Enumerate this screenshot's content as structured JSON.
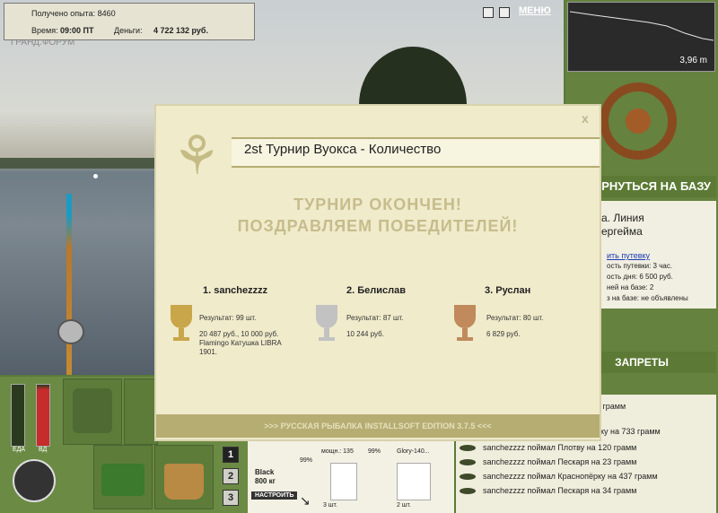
{
  "hud": {
    "experience": "Получено опыта: 8460",
    "time_label": "Время:",
    "time_value": "09:00 ПТ",
    "money_label": "Деньги:",
    "money_value": "4 722 132 руб.",
    "menu_label": "МЕНЮ",
    "depth": "3,96 m",
    "scene_watermark": "ГРАНД.ФОРУМ"
  },
  "right_panel": {
    "base_button": "РНУТЬСЯ НА БАЗУ",
    "location_line1": "а. Линия",
    "location_line2": "ергейма",
    "voucher_link": "ить путевку",
    "voucher_cost": "ость путевки: 3 час.",
    "day_cost": "ость дня: 6 500 руб.",
    "days_on_base": "ней на базе: 2",
    "tournament_status": "з на базе: не объявлены",
    "bans_label": "ЗАПРЕТЫ"
  },
  "log": {
    "rows": [
      "4 грамм",
      "рку на 733 грамм",
      "sanchezzzz поймал Плотву на 120 грамм",
      "sanchezzzz поймал Пескаря на 23 грамм",
      "sanchezzzz поймал Краснопёрку на 437 грамм",
      "sanchezzzz поймал Пескаря на 34 грамм"
    ]
  },
  "bottom": {
    "food_label": "ЕДА",
    "drink_label": "ВД",
    "page_buttons": [
      "1",
      "2",
      "3"
    ],
    "tackle_name": "Black",
    "tackle_weight": "800 кг",
    "tackle_percent": "99%",
    "adjust_button": "НАСТРОИТЬ",
    "inv_item1": "мощн.: 135",
    "inv_item1_pct": "99%",
    "inv_item2": "Glory-140...",
    "inv_count1": "3 шт.",
    "inv_count2": "2 шт."
  },
  "modal": {
    "title": "2st Турнир Вуокса - Количество",
    "close": "x",
    "headline1": "ТУРНИР ОКОНЧЕН!",
    "headline2": "ПОЗДРАВЛЯЕМ ПОБЕДИТЕЛЕЙ!",
    "footer": ">>> РУССКАЯ РЫБАЛКА INSTALLSOFT EDITION 3.7.5 <<<",
    "winners": [
      {
        "name": "1. sanchezzzz",
        "result": "Результат: 99 шт.",
        "prize": "20 487 руб., 10 000 руб. Flamingo Катушка LIBRA 1901."
      },
      {
        "name": "2. Белислав",
        "result": "Результат: 87 шт.",
        "prize": "10 244 руб."
      },
      {
        "name": "3. Руслан",
        "result": "Результат: 80 шт.",
        "prize": "6 829 руб."
      }
    ]
  },
  "colors": {
    "gold": "#c9a64a",
    "silver": "#c2c2c2",
    "bronze": "#c08a5c",
    "panel_green": "#5c7a35"
  }
}
